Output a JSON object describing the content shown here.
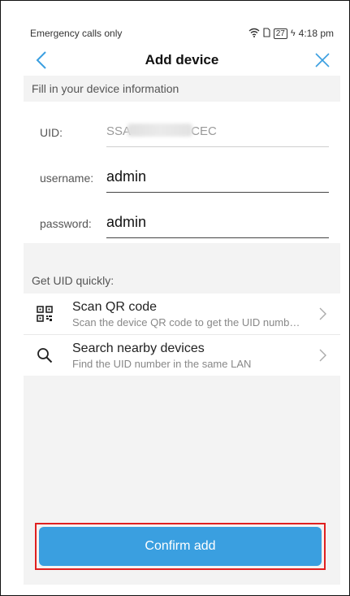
{
  "status_bar": {
    "left_text": "Emergency calls only",
    "battery": "27",
    "time": "4:18 pm"
  },
  "nav": {
    "title": "Add device",
    "back_icon": "chevron-left-icon",
    "close_icon": "close-icon"
  },
  "form": {
    "header": "Fill in your device information",
    "uid_label": "UID:",
    "uid_value": "SSA                  CEC",
    "username_label": "username:",
    "username_value": "admin",
    "password_label": "password:",
    "password_value": "admin"
  },
  "quick": {
    "header": "Get UID quickly:",
    "items": [
      {
        "title": "Scan QR code",
        "subtitle": "Scan the device QR code to get the UID numb…",
        "icon": "qr-code-icon"
      },
      {
        "title": "Search nearby devices",
        "subtitle": "Find the UID number in the same LAN",
        "icon": "search-icon"
      }
    ]
  },
  "confirm_label": "Confirm add",
  "colors": {
    "accent": "#3a9fe0",
    "highlight": "#e02020"
  }
}
